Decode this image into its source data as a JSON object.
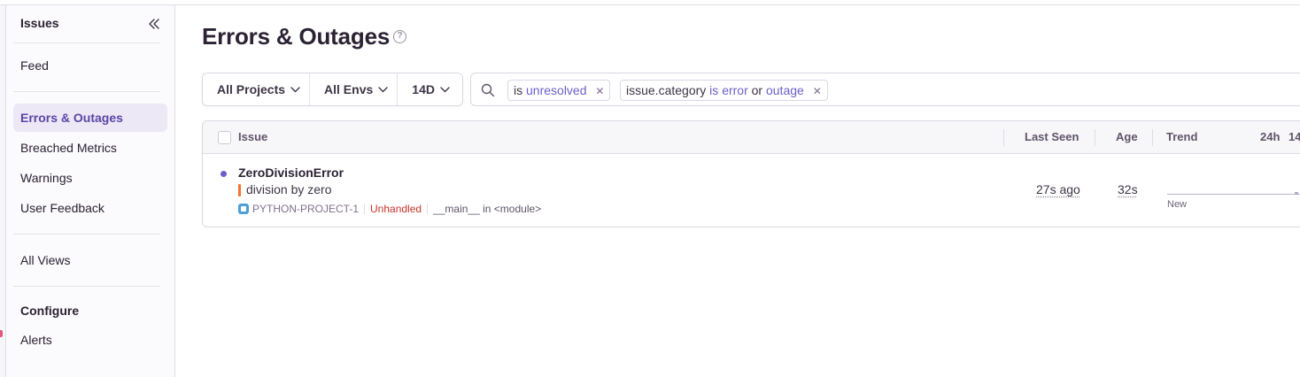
{
  "sidebar": {
    "header": "Issues",
    "items": [
      {
        "label": "Feed",
        "active": false
      },
      {
        "label": "Errors & Outages",
        "active": true
      },
      {
        "label": "Breached Metrics",
        "active": false
      },
      {
        "label": "Warnings",
        "active": false
      },
      {
        "label": "User Feedback",
        "active": false
      },
      {
        "label": "All Views",
        "active": false
      }
    ],
    "configure": {
      "title": "Configure",
      "items": [
        {
          "label": "Alerts"
        }
      ]
    }
  },
  "page": {
    "title": "Errors & Outages"
  },
  "filters": {
    "project": "All Projects",
    "env": "All Envs",
    "period": "14D"
  },
  "search": {
    "tokens": [
      {
        "key": "",
        "op": "is",
        "values": [
          "unresolved"
        ],
        "conj": ""
      },
      {
        "key": "issue.category",
        "op": "is",
        "values": [
          "error",
          "outage"
        ],
        "conj": "or"
      }
    ]
  },
  "table": {
    "columns": {
      "issue": "Issue",
      "last_seen": "Last Seen",
      "age": "Age",
      "trend": "Trend",
      "period_24h": "24h",
      "period_14d": "14"
    },
    "rows": [
      {
        "title": "ZeroDivisionError",
        "message": "division by zero",
        "project": "PYTHON-PROJECT-1",
        "handled": "Unhandled",
        "culprit": "__main__ in <module>",
        "last_seen": "27s ago",
        "age": "32s",
        "trend_label": "New"
      }
    ]
  },
  "colors": {
    "accent": "#6c5fc7",
    "active_bg": "#ece8f5",
    "unhandled": "#c4332a",
    "level_bar": "#f3732f"
  }
}
